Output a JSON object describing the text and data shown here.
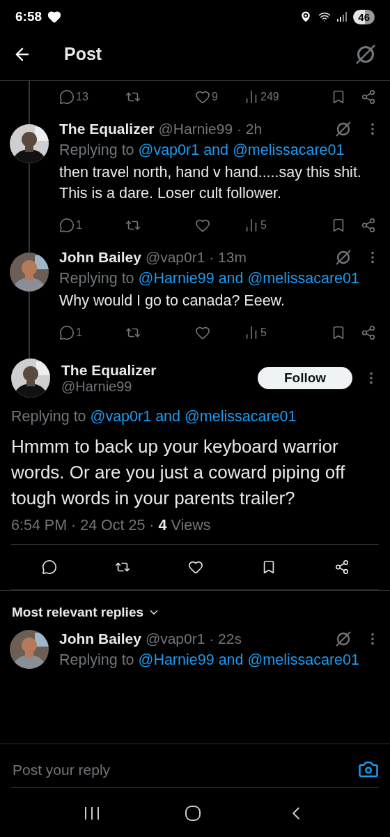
{
  "status_bar": {
    "time": "6:58",
    "battery": "46"
  },
  "header": {
    "title": "Post"
  },
  "thread_top": {
    "actions": [
      {
        "kind": "reply",
        "count": "13"
      },
      {
        "kind": "repost"
      },
      {
        "kind": "like",
        "count": "9"
      },
      {
        "kind": "views",
        "count": "249"
      },
      {
        "kind": "bookmark"
      },
      {
        "kind": "share"
      }
    ]
  },
  "thread_replies": [
    {
      "name": "The Equalizer",
      "meta": "@Harnie99 · 2h",
      "replying": {
        "label": "Replying to",
        "mentions": [
          "@vap0r1",
          "@melissacare01"
        ],
        "joiner": "and"
      },
      "text": "then travel north, hand v hand.....say this shit. This is a dare. Loser cult follower.",
      "actions": [
        {
          "kind": "reply",
          "count": "1"
        },
        {
          "kind": "repost"
        },
        {
          "kind": "like"
        },
        {
          "kind": "views",
          "count": "5"
        },
        {
          "kind": "bookmark"
        },
        {
          "kind": "share"
        }
      ]
    },
    {
      "name": "John Bailey",
      "meta": "@vap0r1 · 13m",
      "replying": {
        "label": "Replying to",
        "mentions": [
          "@Harnie99",
          "@melissacare01"
        ],
        "joiner": "and"
      },
      "text": "Why would I go to canada? Eeew.",
      "actions": [
        {
          "kind": "reply",
          "count": "1"
        },
        {
          "kind": "repost"
        },
        {
          "kind": "like"
        },
        {
          "kind": "views",
          "count": "5"
        },
        {
          "kind": "bookmark"
        },
        {
          "kind": "share"
        }
      ]
    }
  ],
  "main_post": {
    "name": "The Equalizer",
    "handle": "@Harnie99",
    "follow_label": "Follow",
    "replying": {
      "label": "Replying to",
      "mentions": [
        "@vap0r1",
        "@melissacare01"
      ],
      "joiner": "and"
    },
    "text": "Hmmm to back up your keyboard warrior words. Or are you just a coward piping off tough words in your parents trailer?",
    "meta": "6:54 PM · 24 Oct 25 · **4** Views",
    "actions": [
      {
        "kind": "reply"
      },
      {
        "kind": "repost"
      },
      {
        "kind": "like"
      },
      {
        "kind": "bookmark"
      },
      {
        "kind": "share"
      }
    ]
  },
  "replies_section": {
    "title": "Most relevant replies"
  },
  "replies": [
    {
      "name": "John Bailey",
      "meta": "@vap0r1 · 22s",
      "replying": {
        "label": "Replying to",
        "mentions": [
          "@Harnie99",
          "@melissacare01"
        ],
        "joiner": "and"
      }
    }
  ],
  "composer": {
    "placeholder": "Post your reply"
  }
}
